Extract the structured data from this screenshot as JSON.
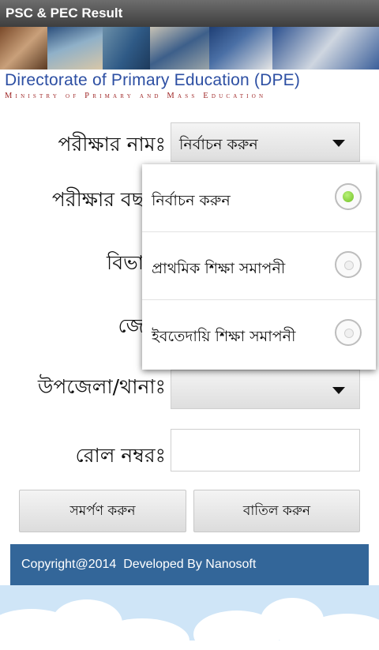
{
  "app": {
    "title": "PSC & PEC Result"
  },
  "banner": {
    "title": "Directorate of Primary Education (DPE)",
    "subtitle": "Ministry of Primary and Mass Education"
  },
  "form": {
    "exam_name_label": "পরীক্ষার নামঃ",
    "exam_name_value": "নির্বাচন করুন",
    "exam_year_label": "পরীক্ষার বছ",
    "division_label": "বিভা",
    "district_label": "জে",
    "upazila_label": "উপজেলা/থানাঃ",
    "roll_label": "রোল নম্বরঃ",
    "roll_value": ""
  },
  "buttons": {
    "submit": "সমর্পণ করুন",
    "cancel": "বাতিল করুন"
  },
  "dropdown": {
    "options": [
      {
        "label": "নির্বাচন করুন",
        "selected": true
      },
      {
        "label": "প্রাথমিক শিক্ষা সমাপনী",
        "selected": false
      },
      {
        "label": "ইবতেদায়ি শিক্ষা সমাপনী",
        "selected": false
      }
    ]
  },
  "footer": {
    "text": "Copyright@2014  Developed By Nanosoft"
  },
  "colors": {
    "footer_bg": "#336699",
    "radio_selected": "#7ccb2d",
    "banner_title": "#2d4fa3",
    "banner_sub": "#a02828"
  }
}
